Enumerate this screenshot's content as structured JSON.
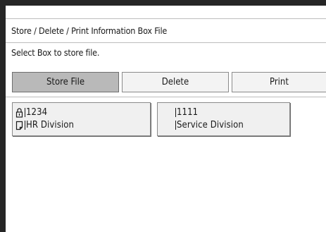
{
  "screen": {
    "title": "Store / Delete / Print Information Box File",
    "instruction": "Select Box to store file."
  },
  "tabs": [
    {
      "label": "Store File",
      "active": true
    },
    {
      "label": "Delete",
      "active": false
    },
    {
      "label": "Print",
      "active": false
    }
  ],
  "boxes": [
    {
      "number": "1234",
      "name": "HR Division",
      "icons": [
        "lock-icon",
        "document-icon"
      ]
    },
    {
      "number": "1111",
      "name": "Service Division",
      "icons": []
    }
  ]
}
